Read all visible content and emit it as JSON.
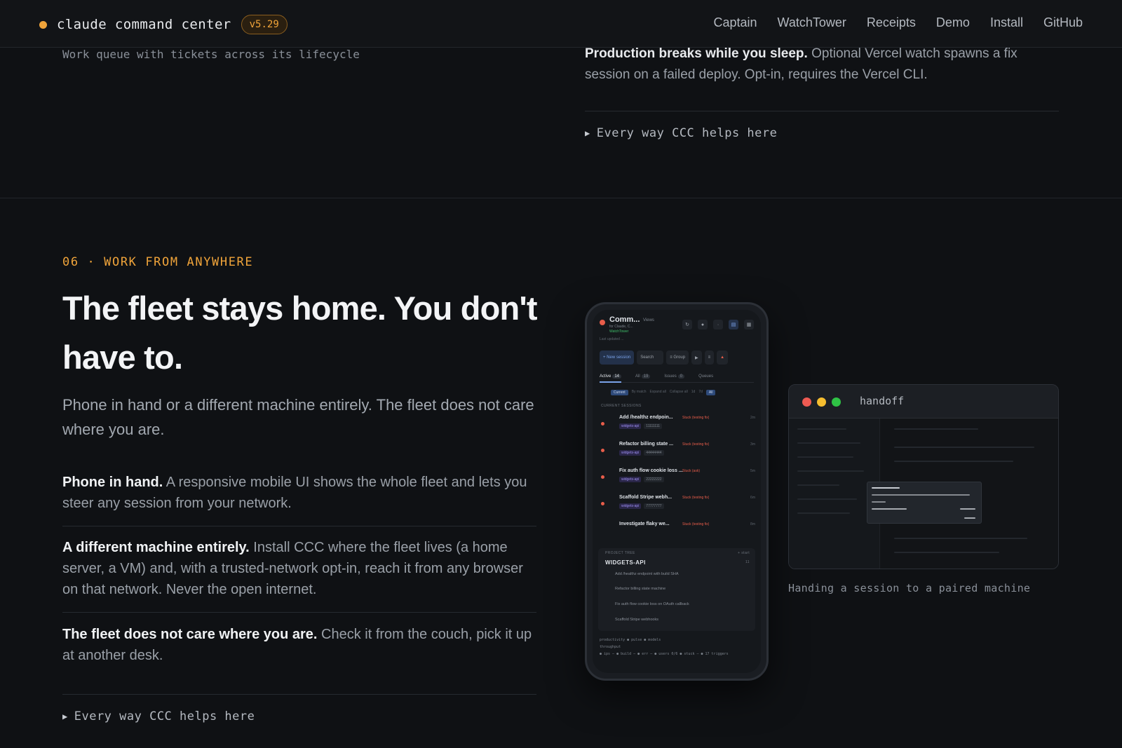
{
  "header": {
    "brand": "claude command center",
    "version": "v5.29",
    "nav": [
      "Captain",
      "WatchTower",
      "Receipts",
      "Demo",
      "Install",
      "GitHub"
    ]
  },
  "previous_section": {
    "left_caption": "Work queue with tickets across its lifecycle",
    "right_lead": "Production breaks while you sleep.",
    "right_body": "Optional Vercel watch spawns a fix session on a failed deploy. Opt-in, requires the Vercel CLI.",
    "details_label": "Every way CCC helps here"
  },
  "section": {
    "eyebrow": "06 · WORK FROM ANYWHERE",
    "headline": "The fleet stays home. You don't have to.",
    "lede": "Phone in hand or a different machine entirely. The fleet does not care where you are.",
    "features": [
      {
        "lead": "Phone in hand.",
        "body": "A responsive mobile UI shows the whole fleet and lets you steer any session from your network."
      },
      {
        "lead": "A different machine entirely.",
        "body": "Install CCC where the fleet lives (a home server, a VM) and, with a trusted-network opt-in, reach it from any browser on that network. Never the open internet."
      },
      {
        "lead": "The fleet does not care where you are.",
        "body": "Check it from the couch, pick it up at another desk."
      }
    ],
    "details_label": "Every way CCC helps here"
  },
  "phone": {
    "title": "Comm...",
    "subtitle": "for Claude, C...",
    "watchtower": "WatchTower",
    "views": "Views",
    "updated": "Last updated ...",
    "toolbar": {
      "new_session": "+ New session",
      "search": "Search",
      "group": "≡ Group"
    },
    "tabs": [
      {
        "label": "Active",
        "count": "14"
      },
      {
        "label": "All",
        "count": "19"
      },
      {
        "label": "Issues",
        "count": "0"
      },
      {
        "label": "Queues",
        "count": ""
      }
    ],
    "filters": [
      "Current",
      "By match",
      "Expand all",
      "Collapse all",
      "1d",
      "7d",
      "All"
    ],
    "current_sessions_label": "CURRENT SESSIONS",
    "sessions": [
      {
        "title": "Add /healthz endpoin...",
        "tag": "Stuck (testing fix)",
        "repo": "widgets-api",
        "hash": "11111111",
        "time": "2m"
      },
      {
        "title": "Refactor billing state ...",
        "tag": "Stuck (testing fix)",
        "repo": "widgets-api",
        "hash": "44444444",
        "time": "3m"
      },
      {
        "title": "Fix auth flow cookie loss ...",
        "tag": "Stuck (ask)",
        "repo": "widgets-api",
        "hash": "22222222",
        "time": "5m"
      },
      {
        "title": "Scaffold Stripe webh...",
        "tag": "Stuck (testing fix)",
        "repo": "widgets-api",
        "hash": "77777777",
        "time": "6m"
      },
      {
        "title": "Investigate flaky we...",
        "tag": "Stuck (testing fix)",
        "repo": "",
        "hash": "",
        "time": "8m"
      }
    ],
    "project_tree_label": "PROJECT TREE",
    "project_tree_action": "+ start",
    "project": "WIDGETS-API",
    "project_count": "11",
    "project_items": [
      "Add /healthz endpoint with build SHA",
      "Refactor billing state machine",
      "Fix auth flow cookie loss on OAuth callback",
      "Scaffold Stripe webhooks"
    ],
    "footer": [
      "productivity   ● pulse   ● models",
      "throughput",
      "● ips — ● build — ● err — ● users 0/6 ● stuck — ● 17 triggers"
    ]
  },
  "handoff": {
    "title": "handoff",
    "caption": "Handing a session to a paired machine"
  }
}
